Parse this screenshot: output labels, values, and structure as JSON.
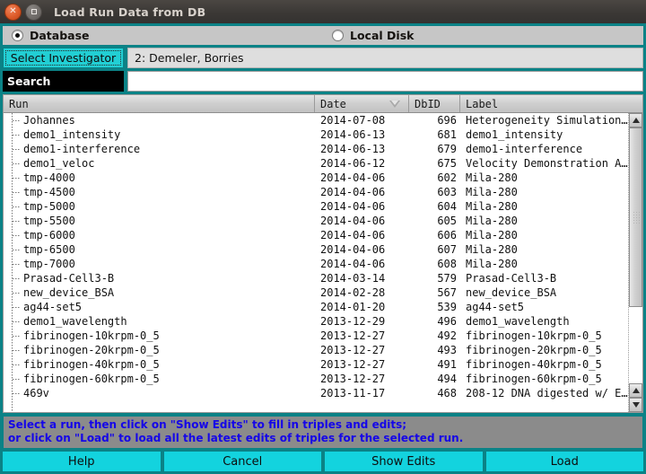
{
  "window": {
    "title": "Load Run Data from DB",
    "close_icon": "close-icon",
    "maximize_icon": "maximize-icon"
  },
  "source": {
    "database_label": "Database",
    "local_disk_label": "Local Disk",
    "selected": "Database"
  },
  "investigator": {
    "button_label": "Select Investigator",
    "value": "2: Demeler, Borries"
  },
  "search": {
    "label": "Search",
    "value": "",
    "placeholder": ""
  },
  "table": {
    "columns": [
      "Run",
      "Date",
      "DbID",
      "Label"
    ],
    "sort_column": "Date",
    "sort_direction": "descending",
    "rows": [
      {
        "run": "Johannes",
        "date": "2014-07-08",
        "dbid": "696",
        "label": "Heterogeneity Simulation…"
      },
      {
        "run": "demo1_intensity",
        "date": "2014-06-13",
        "dbid": "681",
        "label": "demo1_intensity"
      },
      {
        "run": "demo1-interference",
        "date": "2014-06-13",
        "dbid": "679",
        "label": "demo1-interference"
      },
      {
        "run": "demo1_veloc",
        "date": "2014-06-12",
        "dbid": "675",
        "label": "Velocity Demonstration A…"
      },
      {
        "run": "tmp-4000",
        "date": "2014-04-06",
        "dbid": "602",
        "label": "Mila-280"
      },
      {
        "run": "tmp-4500",
        "date": "2014-04-06",
        "dbid": "603",
        "label": "Mila-280"
      },
      {
        "run": "tmp-5000",
        "date": "2014-04-06",
        "dbid": "604",
        "label": "Mila-280"
      },
      {
        "run": "tmp-5500",
        "date": "2014-04-06",
        "dbid": "605",
        "label": "Mila-280"
      },
      {
        "run": "tmp-6000",
        "date": "2014-04-06",
        "dbid": "606",
        "label": "Mila-280"
      },
      {
        "run": "tmp-6500",
        "date": "2014-04-06",
        "dbid": "607",
        "label": "Mila-280"
      },
      {
        "run": "tmp-7000",
        "date": "2014-04-06",
        "dbid": "608",
        "label": "Mila-280"
      },
      {
        "run": "Prasad-Cell3-B",
        "date": "2014-03-14",
        "dbid": "579",
        "label": "Prasad-Cell3-B"
      },
      {
        "run": "new_device_BSA",
        "date": "2014-02-28",
        "dbid": "567",
        "label": "new_device_BSA"
      },
      {
        "run": "ag44-set5",
        "date": "2014-01-20",
        "dbid": "539",
        "label": "ag44-set5"
      },
      {
        "run": "demo1_wavelength",
        "date": "2013-12-29",
        "dbid": "496",
        "label": "demo1_wavelength"
      },
      {
        "run": "fibrinogen-10krpm-0_5",
        "date": "2013-12-27",
        "dbid": "492",
        "label": "fibrinogen-10krpm-0_5"
      },
      {
        "run": "fibrinogen-20krpm-0_5",
        "date": "2013-12-27",
        "dbid": "493",
        "label": "fibrinogen-20krpm-0_5"
      },
      {
        "run": "fibrinogen-40krpm-0_5",
        "date": "2013-12-27",
        "dbid": "491",
        "label": "fibrinogen-40krpm-0_5"
      },
      {
        "run": "fibrinogen-60krpm-0_5",
        "date": "2013-12-27",
        "dbid": "494",
        "label": "fibrinogen-60krpm-0_5"
      },
      {
        "run": "469v",
        "date": "2013-11-17",
        "dbid": "468",
        "label": "208-12 DNA digested w/ E…"
      }
    ]
  },
  "scrollbar": {
    "up_icon": "scroll-up-icon",
    "down_icon": "scroll-down-icon",
    "bottom_up_icon": "scroll-up-icon"
  },
  "hint": {
    "line1": "Select a run, then click on \"Show Edits\" to fill in triples and edits;",
    "line2": "or click on \"Load\" to load all the latest edits of triples for the selected run."
  },
  "footer": {
    "buttons": [
      "Help",
      "Cancel",
      "Show Edits",
      "Load"
    ]
  },
  "colors": {
    "teal_frame": "#0b8286",
    "button_cyan": "#13d3de",
    "hint_text": "#1506e8",
    "hint_bg": "#8b8b8b"
  }
}
